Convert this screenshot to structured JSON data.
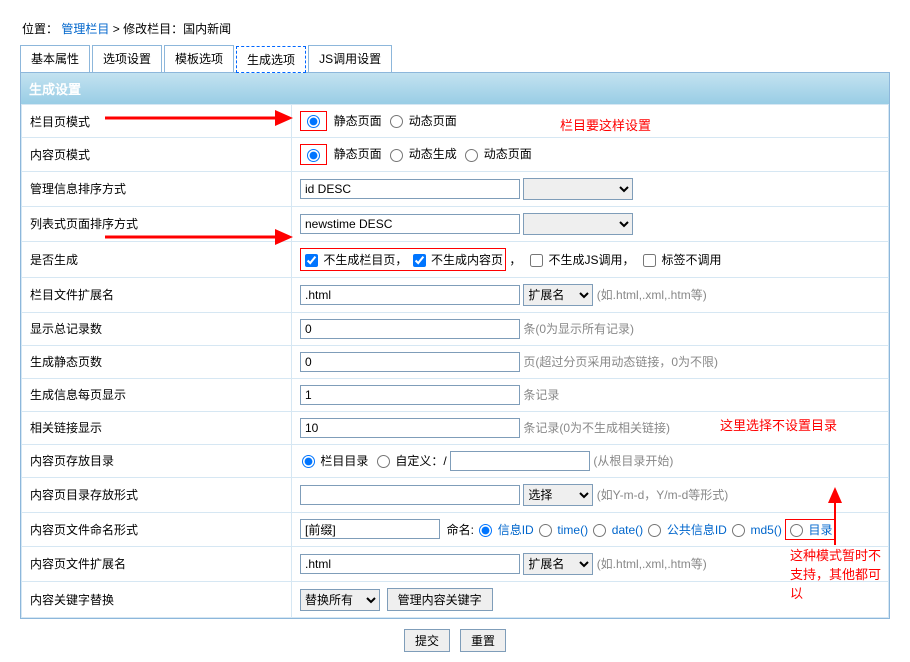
{
  "breadcrumb": {
    "loc_label": "位置：",
    "link": "管理栏目",
    "sep": " > ",
    "current": "修改栏目：国内新闻"
  },
  "tabs": {
    "t1": "基本属性",
    "t2": "选项设置",
    "t3": "模板选项",
    "t4": "生成选项",
    "t5": "JS调用设置"
  },
  "panel_title": "生成设置",
  "rows": {
    "r1_label": "栏目页模式",
    "r1_opt1": "静态页面",
    "r1_opt2": "动态页面",
    "r2_label": "内容页模式",
    "r2_opt1": "静态页面",
    "r2_opt2": "动态生成",
    "r2_opt3": "动态页面",
    "r3_label": "管理信息排序方式",
    "r3_val": "id DESC",
    "r4_label": "列表式页面排序方式",
    "r4_val": "newstime DESC",
    "r5_label": "是否生成",
    "r5_c1": "不生成栏目页，",
    "r5_c2": "不生成内容页",
    "r5_sep": "，",
    "r5_c3": "不生成JS调用，",
    "r5_c4": "标签不调用",
    "r6_label": "栏目文件扩展名",
    "r6_val": ".html",
    "r6_sel": "扩展名",
    "r6_hint": "(如.html,.xml,.htm等)",
    "r7_label": "显示总记录数",
    "r7_val": "0",
    "r7_hint": "条(0为显示所有记录)",
    "r8_label": "生成静态页数",
    "r8_val": "0",
    "r8_hint": "页(超过分页采用动态链接，0为不限)",
    "r9_label": "生成信息每页显示",
    "r9_val": "1",
    "r9_hint": "条记录",
    "r10_label": "相关链接显示",
    "r10_val": "10",
    "r10_hint": "条记录(0为不生成相关链接)",
    "r11_label": "内容页存放目录",
    "r11_opt1": "栏目目录",
    "r11_opt2": "自定义：/",
    "r11_hint": "(从根目录开始)",
    "r12_label": "内容页目录存放形式",
    "r12_sel": "选择",
    "r12_hint": "(如Y-m-d，Y/m-d等形式)",
    "r13_label": "内容页文件命名形式",
    "r13_prefix": "[前缀]",
    "r13_name_label": "命名:",
    "r13_o1": "信息ID",
    "r13_o2": "time()",
    "r13_o3": "date()",
    "r13_o4": "公共信息ID",
    "r13_o5": "md5()",
    "r13_o6": "目录",
    "r14_label": "内容页文件扩展名",
    "r14_val": ".html",
    "r14_sel": "扩展名",
    "r14_hint": "(如.html,.xml,.htm等)",
    "r15_label": "内容关键字替换",
    "r15_sel": "替换所有",
    "r15_btn": "管理内容关键字"
  },
  "annotations": {
    "a1": "栏目要这样设置",
    "a2": "这里选择不设置目录",
    "a3": "这种模式暂时不支持，其他都可以"
  },
  "footer": {
    "submit": "提交",
    "reset": "重置"
  }
}
